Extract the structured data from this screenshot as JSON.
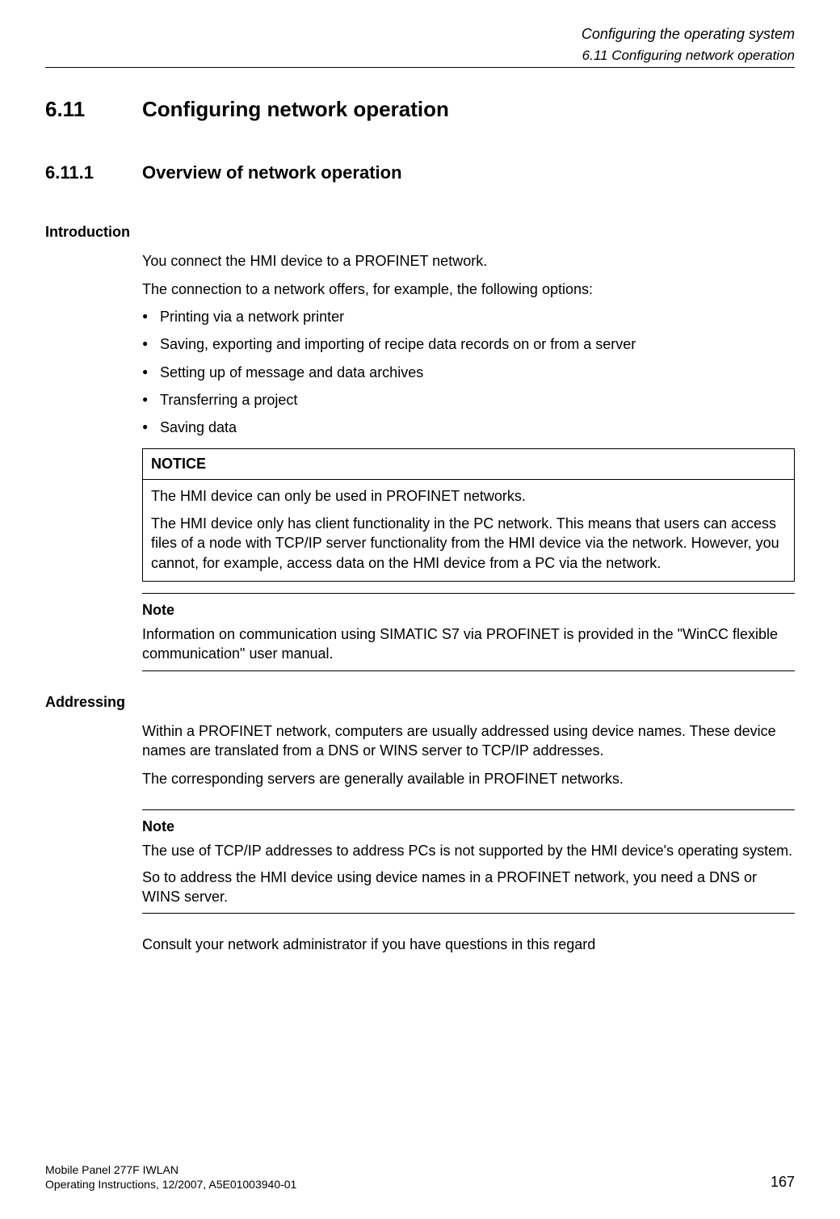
{
  "header": {
    "chapter": "Configuring the operating system",
    "section": "6.11 Configuring network operation"
  },
  "h1": {
    "num": "6.11",
    "title": "Configuring network operation"
  },
  "h2": {
    "num": "6.11.1",
    "title": "Overview of network operation"
  },
  "intro": {
    "heading": "Introduction",
    "p1": "You connect the HMI device to a PROFINET network.",
    "p2": "The connection to a network offers, for example, the following options:",
    "bullets": [
      "Printing via a network printer",
      "Saving, exporting and importing of recipe data records on or from a server",
      "Setting up of message and data archives",
      "Transferring a project",
      "Saving data"
    ]
  },
  "notice": {
    "label": "NOTICE",
    "p1": "The HMI device can only be used in PROFINET networks.",
    "p2": "The HMI device only has client functionality in the PC network. This means that users can access files of a node with TCP/IP server functionality from the HMI device via the network. However, you cannot, for example, access data on the HMI device from a PC via the network."
  },
  "note1": {
    "label": "Note",
    "p1": "Information on communication using SIMATIC S7 via PROFINET is provided in the \"WinCC flexible communication\" user manual."
  },
  "addressing": {
    "heading": "Addressing",
    "p1": "Within a PROFINET network, computers are usually addressed using device names. These device names are translated from a DNS or WINS server to TCP/IP addresses.",
    "p2": "The corresponding servers are generally available in PROFINET networks."
  },
  "note2": {
    "label": "Note",
    "p1": "The use of TCP/IP addresses to address PCs is not supported by the HMI device's operating system.",
    "p2": "So to address the HMI device using device names in a PROFINET network, you need a DNS or WINS server."
  },
  "closing": "Consult your network administrator if you have questions in this regard",
  "footer": {
    "line1": "Mobile Panel 277F IWLAN",
    "line2": "Operating Instructions, 12/2007, A5E01003940-01",
    "page": "167"
  }
}
